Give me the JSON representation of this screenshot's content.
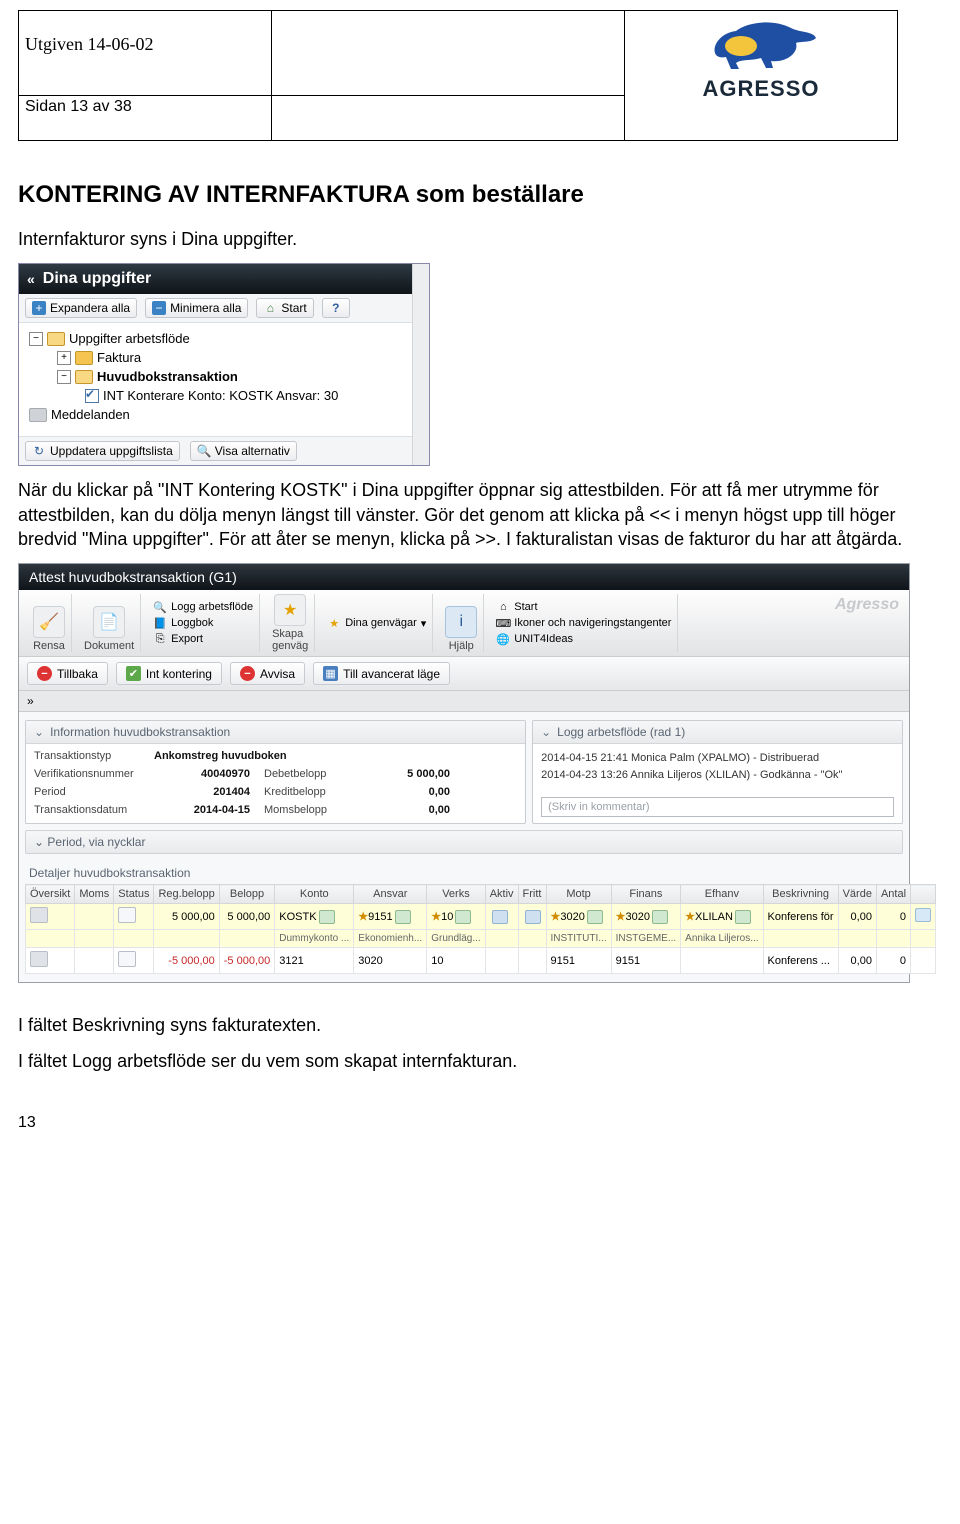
{
  "header": {
    "issued": "Utgiven 14-06-02",
    "page": "Sidan 13 av 38",
    "brand": "AGRESSO"
  },
  "doc": {
    "h2": "KONTERING AV INTERNFAKTURA som beställare",
    "p1": "Internfakturor syns i Dina uppgifter.",
    "p2": "När du klickar på \"INT Kontering KOSTK\" i Dina uppgifter öppnar sig attestbilden. För att få mer utrymme för attestbilden, kan du dölja menyn längst till vänster. Gör det genom att klicka på << i menyn högst upp till höger bredvid \"Mina uppgifter\". För att åter se menyn, klicka på >>. I fakturalistan visas de fakturor du har att åtgärda.",
    "p3": "I fältet Beskrivning syns fakturatexten.",
    "p4": "I fältet Logg arbetsflöde ser du vem som skapat internfakturan.",
    "footnum": "13"
  },
  "sidebar": {
    "title": "Dina uppgifter",
    "toolbar": {
      "expand": "Expandera alla",
      "minimize": "Minimera alla",
      "start": "Start"
    },
    "tree": {
      "root": "Uppgifter arbetsflöde",
      "faktura": "Faktura",
      "huvudbok": "Huvudbokstransaktion",
      "item": "INT Konterare Konto: KOSTK Ansvar: 30",
      "meddelanden": "Meddelanden"
    },
    "bottom": {
      "update": "Uppdatera uppgiftslista",
      "show": "Visa alternativ"
    }
  },
  "app": {
    "title": "Attest huvudbokstransaktion (G1)",
    "ribbon": {
      "rensa": "Rensa",
      "dokument": "Dokument",
      "logg_arb": "Logg arbetsflöde",
      "loggbok": "Loggbok",
      "export": "Export",
      "skapa": "Skapa\ngenväg",
      "genvagar": "Dina genvägar",
      "hjalp": "Hjälp",
      "start": "Start",
      "ikoner": "Ikoner och navigeringstangenter",
      "unit4": "UNIT4Ideas",
      "brand": "Agresso"
    },
    "actions": {
      "tillbaka": "Tillbaka",
      "int": "Int kontering",
      "avvisa": "Avvisa",
      "avancerat": "Till avancerat läge"
    },
    "expander": "»",
    "info": {
      "panel_title": "Information huvudbokstransaktion",
      "transtyp_k": "Transaktionstyp",
      "transtyp_v": "Ankomstreg huvudboken",
      "ver_k": "Verifikationsnummer",
      "ver_v": "40040970",
      "period_k": "Period",
      "period_v": "201404",
      "date_k": "Transaktionsdatum",
      "date_v": "2014-04-15",
      "debet_k": "Debetbelopp",
      "debet_v": "5 000,00",
      "kredit_k": "Kreditbelopp",
      "kredit_v": "0,00",
      "moms_k": "Momsbelopp",
      "moms_v": "0,00"
    },
    "log": {
      "panel_title": "Logg arbetsflöde (rad 1)",
      "l1": "2014-04-15 21:41 Monica Palm (XPALMO) - Distribuerad",
      "l2": "2014-04-23 13:26 Annika Liljeros (XLILAN) - Godkänna - \"Ok\"",
      "placeholder": "(Skriv in kommentar)"
    },
    "period_sub": "Period, via nycklar",
    "details_title": "Detaljer huvudbokstransaktion",
    "grid": {
      "headers": [
        "Översikt",
        "Moms",
        "Status",
        "Reg.belopp",
        "Belopp",
        "Konto",
        "Ansvar",
        "Verks",
        "Aktiv",
        "Fritt",
        "Motp",
        "Finans",
        "Efhanv",
        "Beskrivning",
        "Värde",
        "Antal",
        ""
      ],
      "row1": {
        "reg": "5 000,00",
        "belopp": "5 000,00",
        "konto": "KOSTK",
        "ansvar": "9151",
        "verks": "10",
        "motp": "3020",
        "finans": "3020",
        "efhanv": "XLILAN",
        "beskr": "Konferens för",
        "varde": "0,00",
        "antal": "0",
        "sub_konto": "Dummykonto ...",
        "sub_ansvar": "Ekonomienh...",
        "sub_verks": "Grundläg...",
        "sub_motp": "INSTITUTI...",
        "sub_finans": "INSTGEME...",
        "sub_efh": "Annika Liljeros..."
      },
      "row2": {
        "reg": "-5 000,00",
        "belopp": "-5 000,00",
        "konto": "3121",
        "ansvar": "3020",
        "verks": "10",
        "motp": "9151",
        "finans": "9151",
        "beskr": "Konferens ...",
        "varde": "0,00",
        "antal": "0"
      }
    }
  }
}
